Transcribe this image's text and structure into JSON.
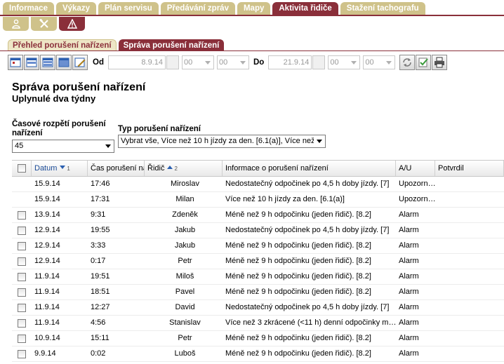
{
  "top_tabs": [
    {
      "label": "Informace",
      "active": false
    },
    {
      "label": "Výkazy",
      "active": false
    },
    {
      "label": "Plán servisu",
      "active": false
    },
    {
      "label": "Předávání zpráv",
      "active": false
    },
    {
      "label": "Mapy",
      "active": false
    },
    {
      "label": "Aktivita řidiče",
      "active": true
    },
    {
      "label": "Stažení tachografu",
      "active": false
    }
  ],
  "icon_tabs": [
    {
      "icon": "person-icon",
      "active": false
    },
    {
      "icon": "tools-icon",
      "active": false
    },
    {
      "icon": "warning-icon",
      "active": true
    }
  ],
  "sub_tabs": [
    {
      "label": "Přehled porušení nařízení",
      "active": false
    },
    {
      "label": "Správa porušení nařízení",
      "active": true
    }
  ],
  "toolbar": {
    "from_label": "Od",
    "from_date": "8.9.14",
    "from_hour": "00",
    "from_minute": "00",
    "to_label": "Do",
    "to_date": "21.9.14",
    "to_hour": "00",
    "to_minute": "00"
  },
  "page": {
    "title": "Správa porušení nařízení",
    "subtitle": "Uplynulé dva týdny"
  },
  "filters": {
    "period_label": "Časové rozpětí porušení nařízení",
    "period_value": "45",
    "type_label": "Typ porušení nařízení",
    "type_value": "Vybrat vše, Více než 10 h jízdy za den. [6.1(a)], Více než"
  },
  "table": {
    "headers": {
      "date": "Datum",
      "date_sort_index": "1",
      "time": "Čas porušení na",
      "driver": "Řidič",
      "driver_sort_index": "2",
      "info": "Informace o porušení nařízení",
      "au": "A/U",
      "confirm": "Potvrdil"
    },
    "rows": [
      {
        "checkbox": false,
        "date": "15.9.14",
        "time": "17:46",
        "driver": "Miroslav",
        "info": "Nedostatečný odpočinek po 4,5 h doby jízdy. [7]",
        "au": "Upozorn…",
        "confirm": ""
      },
      {
        "checkbox": false,
        "date": "15.9.14",
        "time": "17:31",
        "driver": "Milan",
        "info": "Více než 10 h jízdy za den. [6.1(a)]",
        "au": "Upozorn…",
        "confirm": ""
      },
      {
        "checkbox": true,
        "date": "13.9.14",
        "time": "9:31",
        "driver": "Zdeněk",
        "info": "Méně než 9 h odpočinku (jeden řidič). [8.2]",
        "au": "Alarm",
        "confirm": ""
      },
      {
        "checkbox": true,
        "date": "12.9.14",
        "time": "19:55",
        "driver": "Jakub",
        "info": "Nedostatečný odpočinek po 4,5 h doby jízdy. [7]",
        "au": "Alarm",
        "confirm": ""
      },
      {
        "checkbox": true,
        "date": "12.9.14",
        "time": "3:33",
        "driver": "Jakub",
        "info": "Méně než 9 h odpočinku (jeden řidič). [8.2]",
        "au": "Alarm",
        "confirm": ""
      },
      {
        "checkbox": true,
        "date": "12.9.14",
        "time": "0:17",
        "driver": "Petr",
        "info": "Méně než 9 h odpočinku (jeden řidič). [8.2]",
        "au": "Alarm",
        "confirm": ""
      },
      {
        "checkbox": true,
        "date": "11.9.14",
        "time": "19:51",
        "driver": "Miloš",
        "info": "Méně než 9 h odpočinku (jeden řidič). [8.2]",
        "au": "Alarm",
        "confirm": ""
      },
      {
        "checkbox": true,
        "date": "11.9.14",
        "time": "18:51",
        "driver": "Pavel",
        "info": "Méně než 9 h odpočinku (jeden řidič). [8.2]",
        "au": "Alarm",
        "confirm": ""
      },
      {
        "checkbox": true,
        "date": "11.9.14",
        "time": "12:27",
        "driver": "David",
        "info": "Nedostatečný odpočinek po 4,5 h doby jízdy. [7]",
        "au": "Alarm",
        "confirm": ""
      },
      {
        "checkbox": true,
        "date": "11.9.14",
        "time": "4:56",
        "driver": "Stanislav",
        "info": "Více než 3 zkrácené (<11 h) denní odpočinky m…",
        "au": "Alarm",
        "confirm": ""
      },
      {
        "checkbox": true,
        "date": "10.9.14",
        "time": "15:11",
        "driver": "Petr",
        "info": "Méně než 9 h odpočinku (jeden řidič). [8.2]",
        "au": "Alarm",
        "confirm": ""
      },
      {
        "checkbox": true,
        "date": "9.9.14",
        "time": "0:02",
        "driver": "Luboš",
        "info": "Méně než 9 h odpočinku (jeden řidič). [8.2]",
        "au": "Alarm",
        "confirm": ""
      }
    ]
  },
  "colors": {
    "accent": "#8a2f3a",
    "tab_inactive": "#cfc28a"
  }
}
